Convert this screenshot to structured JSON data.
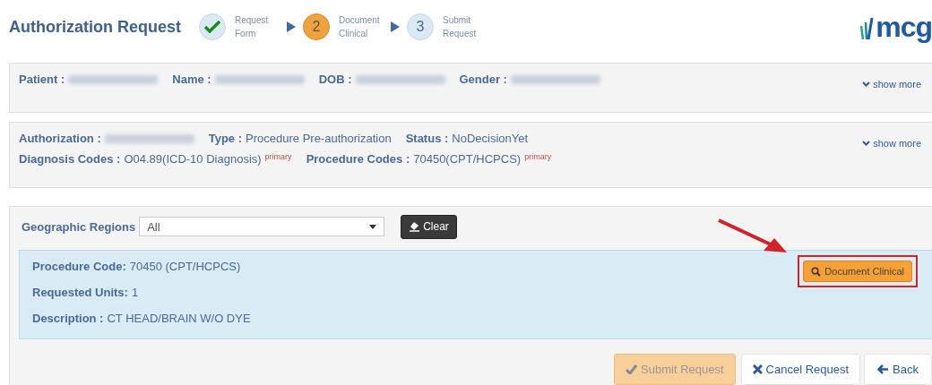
{
  "header": {
    "title": "Authorization Request",
    "logo": "mcg",
    "steps": [
      {
        "kind": "done",
        "label": "Request Form"
      },
      {
        "kind": "current",
        "number": "2",
        "label": "Document Clinical"
      },
      {
        "kind": "pending",
        "number": "3",
        "label": "Submit Request"
      }
    ]
  },
  "patient_panel": {
    "fields": [
      {
        "label": "Patient :",
        "redacted": true
      },
      {
        "label": "Name :",
        "redacted": true
      },
      {
        "label": "DOB :",
        "redacted": true
      },
      {
        "label": "Gender :",
        "redacted": true
      }
    ],
    "toggle": "show more"
  },
  "authorization_panel": {
    "rows": [
      [
        {
          "label": "Authorization :",
          "redacted": true
        },
        {
          "label": "Type :",
          "value": "Procedure Pre-authorization"
        },
        {
          "label": "Status :",
          "value": "NoDecisionYet"
        }
      ],
      [
        {
          "label": "Diagnosis Codes :",
          "value": "O04.89(ICD-10 Diagnosis)",
          "tag": "primary"
        },
        {
          "label": "Procedure Codes :",
          "value": "70450(CPT/HCPCS)",
          "tag": "primary"
        }
      ]
    ],
    "toggle": "show more"
  },
  "regions": {
    "label": "Geographic Regions",
    "value": "All",
    "clear_button": "Clear"
  },
  "procedure": {
    "lines": [
      {
        "label": "Procedure Code:",
        "value": "70450 (CPT/HCPCS)"
      },
      {
        "label": "Requested Units:",
        "value": "1"
      },
      {
        "label": "Description :",
        "value": "CT HEAD/BRAIN W/O DYE"
      }
    ],
    "action": {
      "label": "Document Clinical",
      "highlighted": true
    }
  },
  "footer_buttons": [
    {
      "kind": "submit",
      "label": "Submit Request",
      "disabled": true
    },
    {
      "kind": "cancel",
      "label": "Cancel Request",
      "disabled": false
    },
    {
      "kind": "back",
      "label": "Back",
      "disabled": false
    }
  ]
}
